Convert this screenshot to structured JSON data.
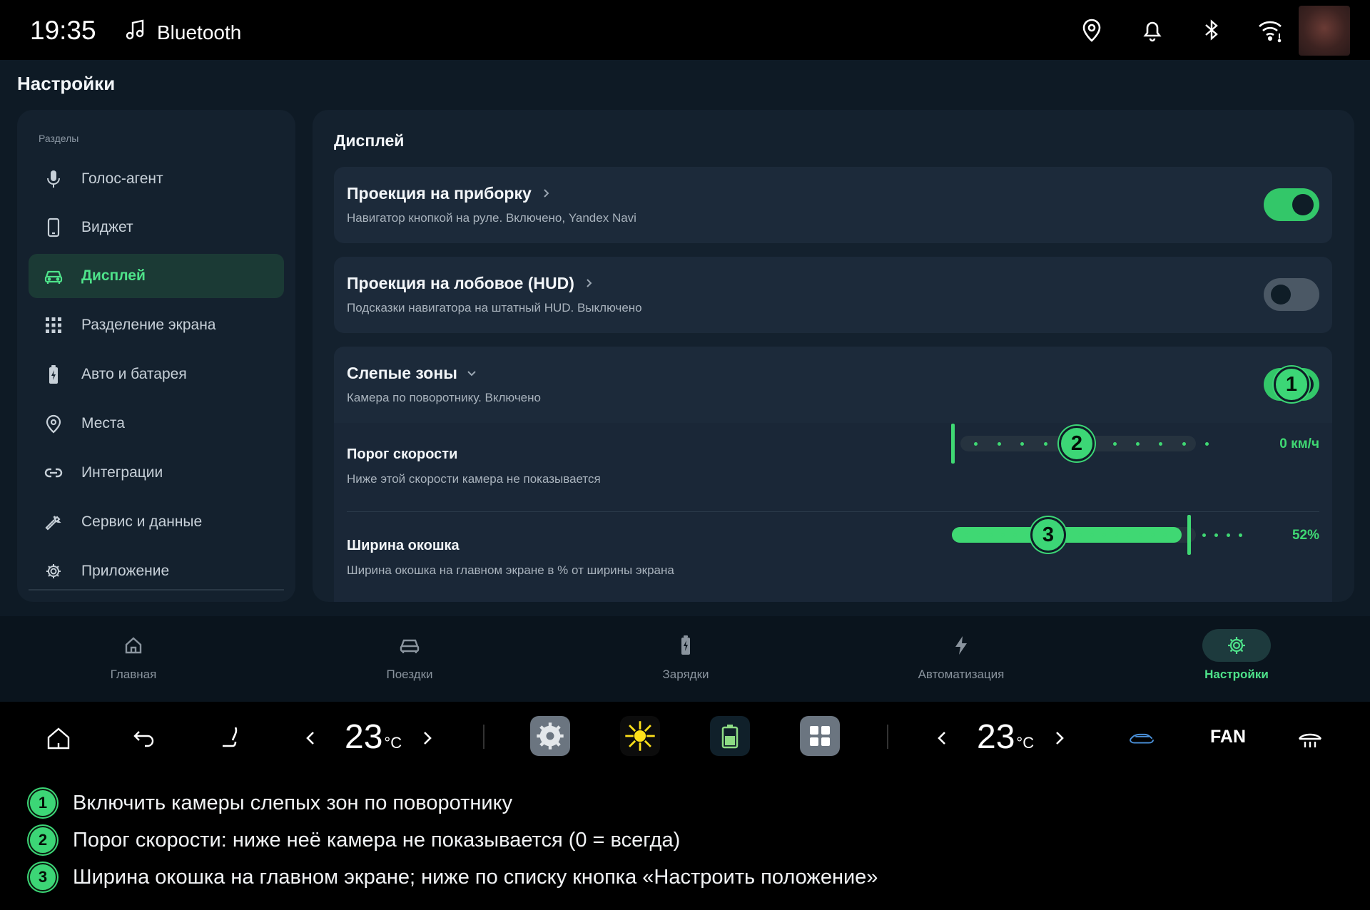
{
  "statusbar": {
    "time": "19:35",
    "media_label": "Bluetooth",
    "icons": [
      "location-pin-icon",
      "bell-icon",
      "bluetooth-icon",
      "wifi-icon"
    ]
  },
  "app": {
    "title": "Настройки"
  },
  "sidebar": {
    "header": "Разделы",
    "items": [
      {
        "label": "Голос-агент",
        "icon": "microphone-icon"
      },
      {
        "label": "Виджет",
        "icon": "phone-icon"
      },
      {
        "label": "Дисплей",
        "icon": "car-icon",
        "active": true
      },
      {
        "label": "Разделение экрана",
        "icon": "grid-icon"
      },
      {
        "label": "Авто и батарея",
        "icon": "battery-icon"
      },
      {
        "label": "Места",
        "icon": "location-pin-icon"
      },
      {
        "label": "Интеграции",
        "icon": "link-icon"
      },
      {
        "label": "Сервис и данные",
        "icon": "wrench-icon"
      },
      {
        "label": "Приложение",
        "icon": "gear-icon"
      }
    ]
  },
  "content": {
    "section_title": "Дисплей",
    "cards": [
      {
        "title": "Проекция на приборку",
        "subtitle": "Навигатор кнопкой на руле. Включено, Yandex Navi",
        "toggle": "on",
        "chevron": "right"
      },
      {
        "title": "Проекция на лобовое (HUD)",
        "subtitle": "Подсказки навигатора на штатный HUD. Выключено",
        "toggle": "off",
        "chevron": "right"
      },
      {
        "title": "Слепые зоны",
        "subtitle": "Камера по поворотнику. Включено",
        "toggle": "on",
        "chevron": "down",
        "settings": [
          {
            "title": "Порог скорости",
            "subtitle": "Ниже этой скорости камера не показывается",
            "value_label": "0 км/ч",
            "value_fraction": 0
          },
          {
            "title": "Ширина окошка",
            "subtitle": "Ширина окошка на главном экране в % от ширины экрана",
            "value_label": "52%",
            "value_fraction": 0.77
          }
        ]
      }
    ]
  },
  "callouts": [
    "1",
    "2",
    "3"
  ],
  "tabbar": {
    "tabs": [
      {
        "label": "Главная",
        "icon": "home-icon"
      },
      {
        "label": "Поездки",
        "icon": "car-icon"
      },
      {
        "label": "Зарядки",
        "icon": "battery-icon"
      },
      {
        "label": "Автоматизация",
        "icon": "lightning-icon"
      },
      {
        "label": "Настройки",
        "icon": "gear-icon",
        "active": true
      }
    ]
  },
  "climate": {
    "left_temp": "23",
    "right_temp": "23",
    "temp_unit": "°C",
    "fan_label": "FAN",
    "icons": [
      "home-outline-icon",
      "back-arrow-icon",
      "seat-heat-icon",
      "chevron-left-icon",
      "chevron-right-icon",
      "settings-app-icon",
      "sun-app-icon",
      "battery-app-icon",
      "grid-app-icon",
      "chevron-left-icon",
      "chevron-right-icon",
      "car-airflow-icon",
      "fan-label",
      "rear-defrost-icon"
    ]
  },
  "legend": [
    {
      "num": "1",
      "text": "Включить камеры слепых зон по поворотнику"
    },
    {
      "num": "2",
      "text": "Порог скорости: ниже неё камера не показывается (0 = всегда)"
    },
    {
      "num": "3",
      "text": "Ширина окошка на главном экране; ниже по списку кнопка «Настроить положение»"
    }
  ],
  "colors": {
    "accent": "#3fd873",
    "app_bg": "#0e1a25",
    "panel_bg": "#14212e",
    "card_bg": "#1c2a3a"
  }
}
